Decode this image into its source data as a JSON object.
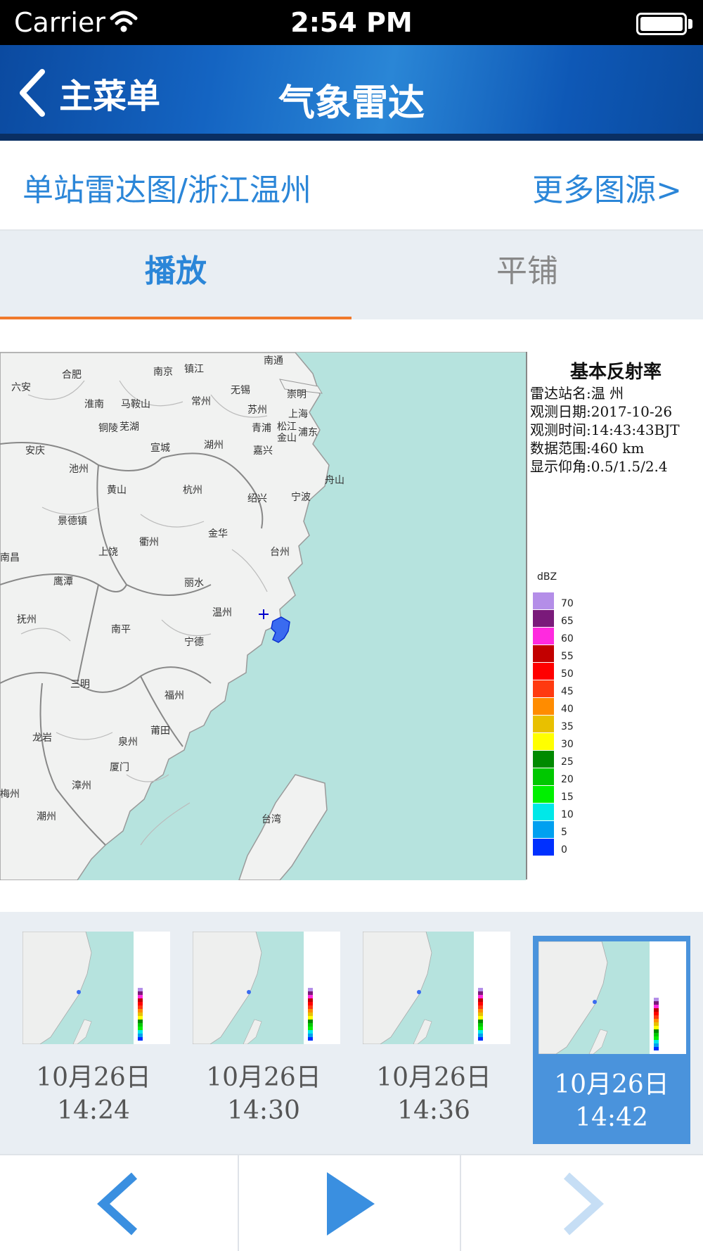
{
  "status_bar": {
    "carrier": "Carrier",
    "time": "2:54 PM"
  },
  "nav": {
    "back_label": "主菜单",
    "title": "气象雷达"
  },
  "source": {
    "title": "单站雷达图/浙江温州",
    "more": "更多图源>"
  },
  "tabs": [
    {
      "label": "播放",
      "active": true
    },
    {
      "label": "平铺",
      "active": false
    }
  ],
  "radar": {
    "legend_title": "基本反射率",
    "info": [
      "雷达站名:温 州",
      "观测日期:2017-10-26",
      "观测时间:14:43:43BJT",
      "数据范围:460 km",
      "显示仰角:0.5/1.5/2.4"
    ],
    "unit": "dBZ",
    "scale": [
      {
        "label": "70",
        "color": "#b48ee8"
      },
      {
        "label": "65",
        "color": "#7a1a7a"
      },
      {
        "label": "60",
        "color": "#ff2adf"
      },
      {
        "label": "55",
        "color": "#c20000"
      },
      {
        "label": "50",
        "color": "#ff0000"
      },
      {
        "label": "45",
        "color": "#ff3a10"
      },
      {
        "label": "40",
        "color": "#ff8c00"
      },
      {
        "label": "35",
        "color": "#e8c000"
      },
      {
        "label": "30",
        "color": "#ffff00"
      },
      {
        "label": "25",
        "color": "#008a00"
      },
      {
        "label": "20",
        "color": "#00c800"
      },
      {
        "label": "15",
        "color": "#00f000"
      },
      {
        "label": "10",
        "color": "#00e8e8"
      },
      {
        "label": "5",
        "color": "#00a0f0"
      },
      {
        "label": "0",
        "color": "#0030ff"
      }
    ],
    "cities": [
      {
        "name": "合肥"
      },
      {
        "name": "南京"
      },
      {
        "name": "镇江"
      },
      {
        "name": "南通"
      },
      {
        "name": "六安"
      },
      {
        "name": "常州"
      },
      {
        "name": "无锡"
      },
      {
        "name": "崇明"
      },
      {
        "name": "淮南"
      },
      {
        "name": "马鞍山"
      },
      {
        "name": "苏州"
      },
      {
        "name": "上海"
      },
      {
        "name": "铜陵"
      },
      {
        "name": "芜湖"
      },
      {
        "name": "青浦"
      },
      {
        "name": "松江"
      },
      {
        "name": "浦东"
      },
      {
        "name": "安庆"
      },
      {
        "name": "宣城"
      },
      {
        "name": "湖州"
      },
      {
        "name": "嘉兴"
      },
      {
        "name": "金山"
      },
      {
        "name": "池州"
      },
      {
        "name": "舟山"
      },
      {
        "name": "黄山"
      },
      {
        "name": "杭州"
      },
      {
        "name": "绍兴"
      },
      {
        "name": "宁波"
      },
      {
        "name": "景德镇"
      },
      {
        "name": "衢州"
      },
      {
        "name": "金华"
      },
      {
        "name": "南昌"
      },
      {
        "name": "上饶"
      },
      {
        "name": "台州"
      },
      {
        "name": "鹰潭"
      },
      {
        "name": "丽水"
      },
      {
        "name": "抚州"
      },
      {
        "name": "温州"
      },
      {
        "name": "南平"
      },
      {
        "name": "宁德"
      },
      {
        "name": "三明"
      },
      {
        "name": "福州"
      },
      {
        "name": "龙岩"
      },
      {
        "name": "莆田"
      },
      {
        "name": "泉州"
      },
      {
        "name": "厦门"
      },
      {
        "name": "漳州"
      },
      {
        "name": "梅州"
      },
      {
        "name": "潮州"
      },
      {
        "name": "台湾"
      }
    ]
  },
  "thumbnails": [
    {
      "date": "10月26日",
      "time": "14:24",
      "selected": false
    },
    {
      "date": "10月26日",
      "time": "14:30",
      "selected": false
    },
    {
      "date": "10月26日",
      "time": "14:36",
      "selected": false
    },
    {
      "date": "10月26日",
      "time": "14:42",
      "selected": true
    }
  ],
  "controls": {
    "prev_icon": "chevron-left-icon",
    "play_icon": "play-icon",
    "next_icon": "chevron-right-icon",
    "active_color": "#3a8fe0",
    "disabled_color": "#c6def5"
  }
}
